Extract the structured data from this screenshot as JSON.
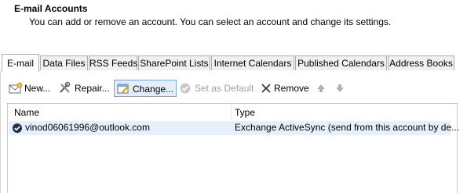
{
  "header": {
    "title": "E-mail Accounts",
    "subtitle": "You can add or remove an account. You can select an account and change its settings."
  },
  "tabs": [
    {
      "label": "E-mail",
      "active": true
    },
    {
      "label": "Data Files"
    },
    {
      "label": "RSS Feeds"
    },
    {
      "label": "SharePoint Lists"
    },
    {
      "label": "Internet Calendars"
    },
    {
      "label": "Published Calendars"
    },
    {
      "label": "Address Books"
    }
  ],
  "toolbar": {
    "new_label": "New...",
    "repair_label": "Repair...",
    "change_label": "Change...",
    "set_default_label": "Set as Default",
    "remove_label": "Remove"
  },
  "list": {
    "columns": [
      "Name",
      "Type"
    ],
    "rows": [
      {
        "name": "vinod06061996@outlook.com",
        "type": "Exchange ActiveSync (send from this account by de..."
      }
    ]
  },
  "icons": [
    "new-mail-icon",
    "repair-tools-icon",
    "change-account-icon",
    "check-circle-icon",
    "remove-x-icon",
    "move-up-icon",
    "move-down-icon",
    "default-account-check-icon"
  ]
}
